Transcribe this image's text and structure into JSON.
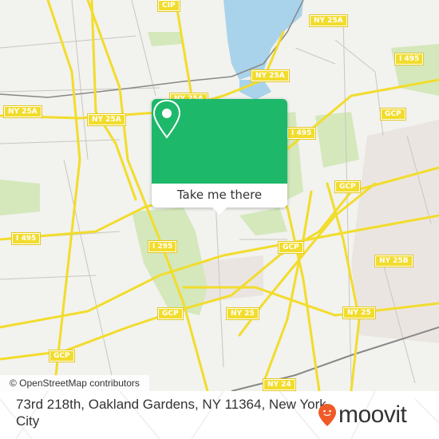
{
  "map": {
    "shields": [
      {
        "label": "CIP"
      },
      {
        "label": "NY 25A"
      },
      {
        "label": "NY 25A"
      },
      {
        "label": "NY 25A"
      },
      {
        "label": "NY 25A"
      },
      {
        "label": "NY 25A"
      },
      {
        "label": "I 495"
      },
      {
        "label": "I 495"
      },
      {
        "label": "I 495"
      },
      {
        "label": "GCP"
      },
      {
        "label": "GCP"
      },
      {
        "label": "GCP"
      },
      {
        "label": "GCP"
      },
      {
        "label": "GCP"
      },
      {
        "label": "I 295"
      },
      {
        "label": "NY 25B"
      },
      {
        "label": "NY 25"
      },
      {
        "label": "NY 25"
      },
      {
        "label": "NY 24"
      }
    ],
    "attribution": "© OpenStreetMap contributors"
  },
  "popup": {
    "button_label": "Take me there",
    "icon": "map-pin-icon"
  },
  "footer": {
    "address": "73rd 218th, Oakland Gardens, NY 11364, New York City",
    "logo_text": "moovit",
    "logo_icon": "moovit-face-pin-icon"
  },
  "colors": {
    "popup_green": "#1eb86a",
    "road_yellow": "#f2dc2c",
    "water": "#a9d3ea",
    "park": "#d4e8bc",
    "logo_orange": "#f05a28"
  }
}
